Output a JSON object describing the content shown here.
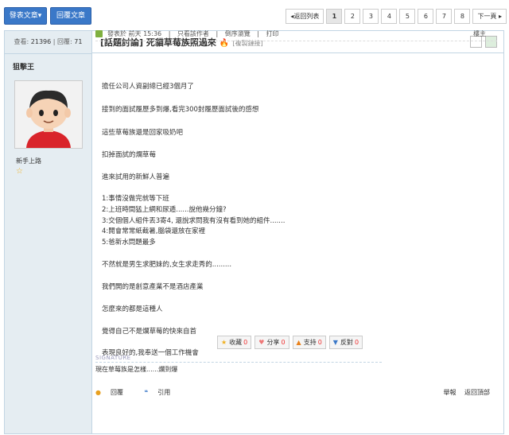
{
  "toolbar": {
    "post_label": "發表文章▾",
    "reply_label": "回覆文章"
  },
  "pager": {
    "back_label": "◂返回列表",
    "pages": [
      "1",
      "2",
      "3",
      "4",
      "5",
      "6",
      "7",
      "8"
    ],
    "current": "1",
    "next_label": "下一頁 ▸"
  },
  "stats": {
    "views_label": "查看:",
    "views": "21396",
    "replies_label": "回覆:",
    "replies": "71"
  },
  "author": {
    "name": "狙擊王",
    "group": "新手上路",
    "star": "☆"
  },
  "thread": {
    "title": "[話題討論] 死貓草莓族照過來",
    "fire": "🔥",
    "copy_link": "[複製鏈接]"
  },
  "meta": {
    "posted": "發表於 前天 15:36",
    "only_author": "只看該作者",
    "reverse": "倒序瀏覽",
    "print": "打印",
    "floor": "樓主"
  },
  "content": [
    "擔任公司人資副總已經3個月了",
    "接到的面試履歷多到爆,看完300封履歷面試後的感想",
    "這些草莓族還是回家吸奶吧",
    "扣掉面試的爛草莓",
    "進來試用的新鮮人普遍",
    "1:事情沒做完就等下班",
    "2:上班時間猛上網和尿遁......說他幾分鐘?",
    "3:交個個人組件丟3寄4, 還說求問我有沒有看到她的組件.......",
    "4:開會常常紙截暑,腦袋還放在家裡",
    "5:爸新水問題最多",
    "不然就是男生求肥妹的,女生求走秀的.........",
    "我們開的是創意產業不是酒店產業",
    "怎麼來的都是這種人",
    "覺得自己不是爛草莓的快來自首",
    "表現良好的,我奉送一個工作機會"
  ],
  "actions": [
    {
      "icon": "★",
      "label": "收藏",
      "count": "0"
    },
    {
      "icon": "♥",
      "label": "分享",
      "count": "0"
    },
    {
      "icon": "▲",
      "label": "支持",
      "count": "0"
    },
    {
      "icon": "▼",
      "label": "反對",
      "count": "0"
    }
  ],
  "signature": {
    "label": "SIGNATURE",
    "text": "現在草莓族是怎樣......爛到爆"
  },
  "footer": {
    "reply": "回覆",
    "quote": "引用",
    "report": "舉報",
    "top": "返回頂部"
  },
  "colors": {
    "accent": "#3a78c8",
    "sidebar_bg": "#e5edf2",
    "border": "#c2d5e3",
    "count_red": "#e33"
  }
}
